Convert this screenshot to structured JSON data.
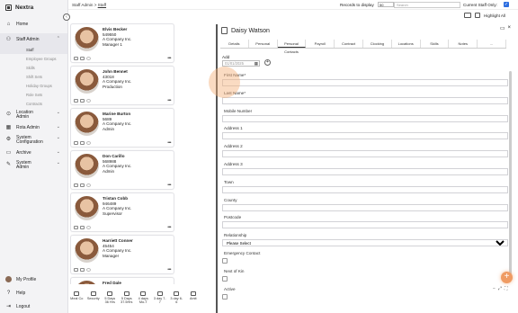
{
  "brand": {
    "name": "Nextra"
  },
  "sidebar": {
    "items": [
      {
        "label": "Home",
        "icon": "home-icon"
      },
      {
        "label": "Staff Admin",
        "icon": "people-icon"
      },
      {
        "label": "Location Admin",
        "icon": "location-icon"
      },
      {
        "label": "Rota Admin",
        "icon": "rota-icon"
      },
      {
        "label": "System Configuration",
        "icon": "gear-icon"
      },
      {
        "label": "Archive",
        "icon": "archive-icon"
      },
      {
        "label": "System Admin",
        "icon": "wrench-icon"
      }
    ],
    "staff_admin_sub": [
      "Staff",
      "Employee Groups",
      "Skills",
      "Shift Sets",
      "Holiday Groups",
      "Role Sets",
      "Contracts"
    ],
    "bottom": [
      {
        "label": "My Profile"
      },
      {
        "label": "Help"
      },
      {
        "label": "Logout"
      }
    ]
  },
  "topbar": {
    "breadcrumb_parent": "Staff Admin",
    "breadcrumb_sep": " > ",
    "breadcrumb_current": "Staff",
    "records_label": "Records to display",
    "records_value": "50",
    "search_placeholder": "Search",
    "current_staff_only": "Current Staff Only:",
    "check": "✓",
    "highlight_all": "Highlight All"
  },
  "staff": [
    {
      "name": "Elvis Becker",
      "id": "549550",
      "company": "A Company Inc.",
      "role": "Manager 1"
    },
    {
      "name": "John Bennet",
      "id": "43018",
      "company": "A Company Inc.",
      "role": "Production"
    },
    {
      "name": "Marine Burton",
      "id": "5689",
      "company": "A Company Inc.",
      "role": "Admin"
    },
    {
      "name": "Don Carillo",
      "id": "568988",
      "company": "A Company Inc.",
      "role": "Admin"
    },
    {
      "name": "Tristan Cobb",
      "id": "946489",
      "company": "A Company Inc.",
      "role": "Supervisor"
    },
    {
      "name": "Harriett Conner",
      "id": "45454",
      "company": "A Company Inc.",
      "role": "Manager"
    },
    {
      "name": "Fred Dale",
      "id": "",
      "company": "",
      "role": ""
    }
  ],
  "filters": [
    {
      "line1": "Meal Co",
      "line2": ""
    },
    {
      "line1": "Security",
      "line2": ""
    },
    {
      "line1": "5 Days",
      "line2": "36 Hrs"
    },
    {
      "line1": "5 Days",
      "line2": "37.5Hrs"
    },
    {
      "line1": "4 days",
      "line2": "Mo-T"
    },
    {
      "line1": "3 day 7-",
      "line2": "7"
    },
    {
      "line1": "3 day 6-",
      "line2": "6"
    },
    {
      "line1": "Amit",
      "line2": ""
    }
  ],
  "detail": {
    "name": "Daisy Watson",
    "tabs": [
      "Details",
      "Personal",
      "Personal Contacts",
      "Payroll",
      "Contract",
      "Clocking",
      "Locations",
      "Skills",
      "Notes",
      "..."
    ],
    "active_tab": "Personal Contacts",
    "add_label": "Add",
    "date_placeholder": "01/01/2025",
    "fields": [
      {
        "label": "First Name*",
        "type": "text"
      },
      {
        "label": "Last Name*",
        "type": "text"
      },
      {
        "label": "Mobile Number",
        "type": "text"
      },
      {
        "label": "Address 1",
        "type": "text"
      },
      {
        "label": "Address 2",
        "type": "text"
      },
      {
        "label": "Address 3",
        "type": "text"
      },
      {
        "label": "Town",
        "type": "text"
      },
      {
        "label": "County",
        "type": "text"
      },
      {
        "label": "Postcode",
        "type": "text"
      },
      {
        "label": "Relationship",
        "type": "select",
        "value": "Please Select"
      },
      {
        "label": "Emergency Contact",
        "type": "checkbox"
      },
      {
        "label": "Next of Kin",
        "type": "checkbox"
      },
      {
        "label": "Active",
        "type": "checkbox"
      }
    ]
  },
  "fab": "+",
  "colors": {
    "accent": "#2d6ee0",
    "fab": "#ef9b63",
    "sidebar_bg": "#f3f3f5"
  }
}
